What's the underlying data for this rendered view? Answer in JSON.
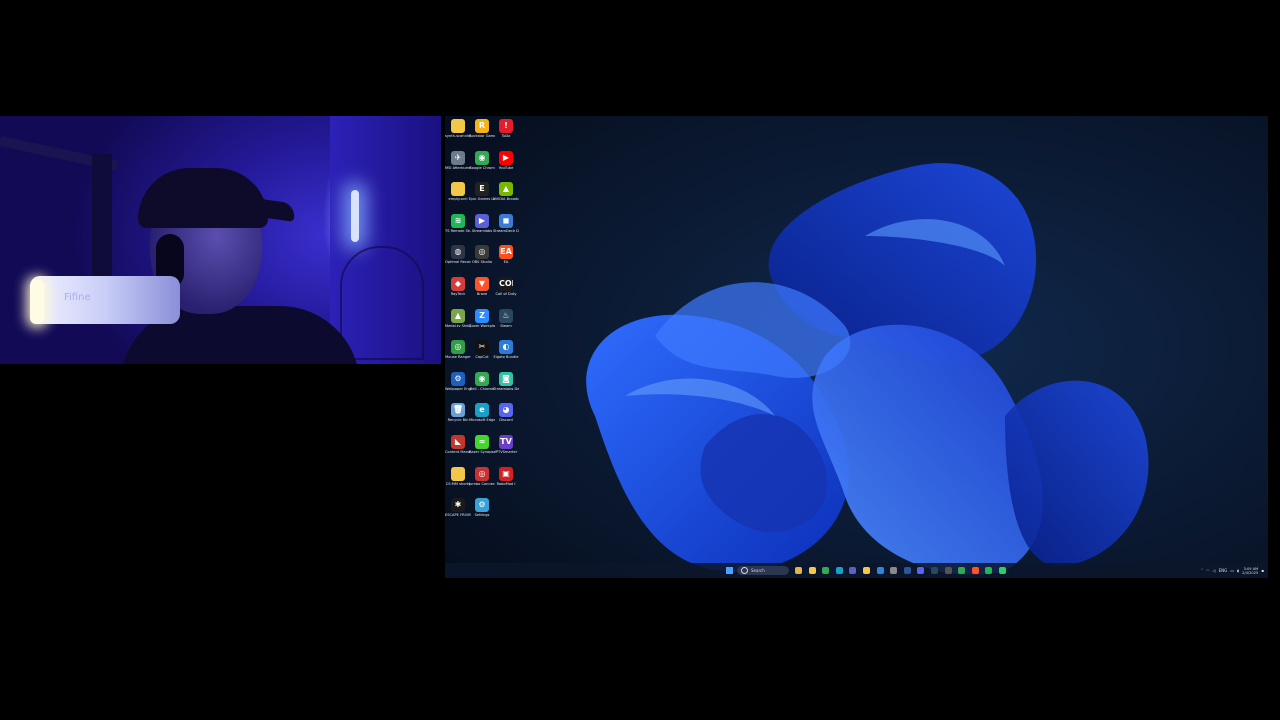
{
  "webcam": {
    "mic_brand": "Fifine"
  },
  "desktop_icons": [
    {
      "label": "synth-scanning",
      "icon": "folder-icon",
      "color": "#f3c74a",
      "glyph": ""
    },
    {
      "label": "Rockstar Games",
      "icon": "rockstar-icon",
      "color": "#f4b21c",
      "glyph": "R"
    },
    {
      "label": "ToDo",
      "icon": "todo-icon",
      "color": "#e31d2b",
      "glyph": "!"
    },
    {
      "label": "MSI Afterburner",
      "icon": "afterburner-icon",
      "color": "#6d7c8a",
      "glyph": "✈"
    },
    {
      "label": "Google Chrome",
      "icon": "chrome-icon",
      "color": "#34a853",
      "glyph": "◉"
    },
    {
      "label": "YouTube",
      "icon": "youtube-icon",
      "color": "#ff0000",
      "glyph": "▶"
    },
    {
      "label": "empty.ovrl",
      "icon": "folder-icon",
      "color": "#f3c74a",
      "glyph": ""
    },
    {
      "label": "Epic Games Launcher",
      "icon": "epic-games-icon",
      "color": "#222222",
      "glyph": "E"
    },
    {
      "label": "NVIDIA Broadcast",
      "icon": "nvidia-broadcast-icon",
      "color": "#76b900",
      "glyph": "▲"
    },
    {
      "label": "TS Remote Studio",
      "icon": "spotify-icon",
      "color": "#1db954",
      "glyph": "≋"
    },
    {
      "label": "Streamlabs",
      "icon": "streamlabs-icon",
      "color": "#5a5fd6",
      "glyph": "▶"
    },
    {
      "label": "StreamDeck Desktop",
      "icon": "streamdeck-icon",
      "color": "#3a7bd5",
      "glyph": "◼"
    },
    {
      "label": "Optimal Recorder",
      "icon": "recorder-icon",
      "color": "#2e3548",
      "glyph": "◍"
    },
    {
      "label": "OBS Studio",
      "icon": "obs-icon",
      "color": "#3a3a3a",
      "glyph": "◎"
    },
    {
      "label": "EA",
      "icon": "ea-icon",
      "color": "#ff4f1a",
      "glyph": "EA"
    },
    {
      "label": "RayTeck",
      "icon": "rayteck-icon",
      "color": "#d83b3b",
      "glyph": "◆"
    },
    {
      "label": "Brave",
      "icon": "brave-icon",
      "color": "#fb542b",
      "glyph": "▼"
    },
    {
      "label": "Call of Duty",
      "icon": "cod-icon",
      "color": "#1a1a1a",
      "glyph": "COD"
    },
    {
      "label": "Medal.tv Shell/pyrotech",
      "icon": "medal-icon",
      "color": "#7aa64a",
      "glyph": "▲"
    },
    {
      "label": "Zoom Workplace",
      "icon": "zoom-icon",
      "color": "#2d8cff",
      "glyph": "Z"
    },
    {
      "label": "Steam",
      "icon": "steam-icon",
      "color": "#2a475e",
      "glyph": "♨"
    },
    {
      "label": "Mouse Ranger",
      "icon": "mouse-icon",
      "color": "#2f9e44",
      "glyph": "◎"
    },
    {
      "label": "CapCut",
      "icon": "capcut-icon",
      "color": "#111111",
      "glyph": "✂"
    },
    {
      "label": "Elgato Bundle",
      "icon": "elgato-icon",
      "color": "#2d7bd8",
      "glyph": "◐"
    },
    {
      "label": "Wallpaper Engine",
      "icon": "wallpaper-engine-icon",
      "color": "#1f5fbf",
      "glyph": "⚙"
    },
    {
      "label": "Bell - Chrome",
      "icon": "chrome-icon",
      "color": "#34a853",
      "glyph": "◉"
    },
    {
      "label": "Streamlabs Desktop",
      "icon": "streamlabs-icon",
      "color": "#31c3a2",
      "glyph": "◙"
    },
    {
      "label": "Recycle Bin",
      "icon": "recycle-bin-icon",
      "color": "#6a9fd8",
      "glyph": "🗑"
    },
    {
      "label": "Microsoft Edge",
      "icon": "edge-icon",
      "color": "#1aa0c7",
      "glyph": "e"
    },
    {
      "label": "Discord",
      "icon": "discord-icon",
      "color": "#5865f2",
      "glyph": "◕"
    },
    {
      "label": "Content Manager",
      "icon": "content-manager-icon",
      "color": "#c0392b",
      "glyph": "◣"
    },
    {
      "label": "Razer Synapse",
      "icon": "razer-icon",
      "color": "#44d62c",
      "glyph": "≈"
    },
    {
      "label": "IPTVSmarter",
      "icon": "iptv-icon",
      "color": "#6a3ec9",
      "glyph": "TV"
    },
    {
      "label": "CS:MM shorts",
      "icon": "folder-icon",
      "color": "#f3c74a",
      "glyph": ""
    },
    {
      "label": "Jumbo Connect",
      "icon": "jumbo-icon",
      "color": "#c93232",
      "glyph": "◎"
    },
    {
      "label": "RoboMod I",
      "icon": "robomod-icon",
      "color": "#d42020",
      "glyph": "▣"
    },
    {
      "label": "ESCAPE FROM TAR",
      "icon": "eft-icon",
      "color": "#1a1a1a",
      "glyph": "✱"
    },
    {
      "label": "Settings",
      "icon": "settings-icon",
      "color": "#3aa0d8",
      "glyph": "⚙"
    }
  ],
  "taskbar": {
    "search_label": "Search",
    "apps": [
      {
        "icon": "widgets-icon",
        "color": "#e2b54a"
      },
      {
        "icon": "file-explorer-icon",
        "color": "#f3c74a"
      },
      {
        "icon": "chrome-icon",
        "color": "#34a853"
      },
      {
        "icon": "edge-icon",
        "color": "#1aa0c7"
      },
      {
        "icon": "teams-icon",
        "color": "#5b5fc7"
      },
      {
        "icon": "folder-icon",
        "color": "#f3c74a"
      },
      {
        "icon": "store-icon",
        "color": "#2b88d8"
      },
      {
        "icon": "calculator-icon",
        "color": "#8a8a8a"
      },
      {
        "icon": "word-icon",
        "color": "#2b579a"
      },
      {
        "icon": "discord-icon",
        "color": "#5865f2"
      },
      {
        "icon": "steam-icon",
        "color": "#2a475e"
      },
      {
        "icon": "obs-icon",
        "color": "#555555"
      },
      {
        "icon": "chrome-icon",
        "color": "#34a853"
      },
      {
        "icon": "brave-icon",
        "color": "#fb542b"
      },
      {
        "icon": "spotify-icon",
        "color": "#1db954"
      },
      {
        "icon": "whatsapp-icon",
        "color": "#25d366"
      }
    ],
    "tray": {
      "language": "ENG",
      "time": "3:09 AM",
      "date": "2/4/2025"
    }
  }
}
